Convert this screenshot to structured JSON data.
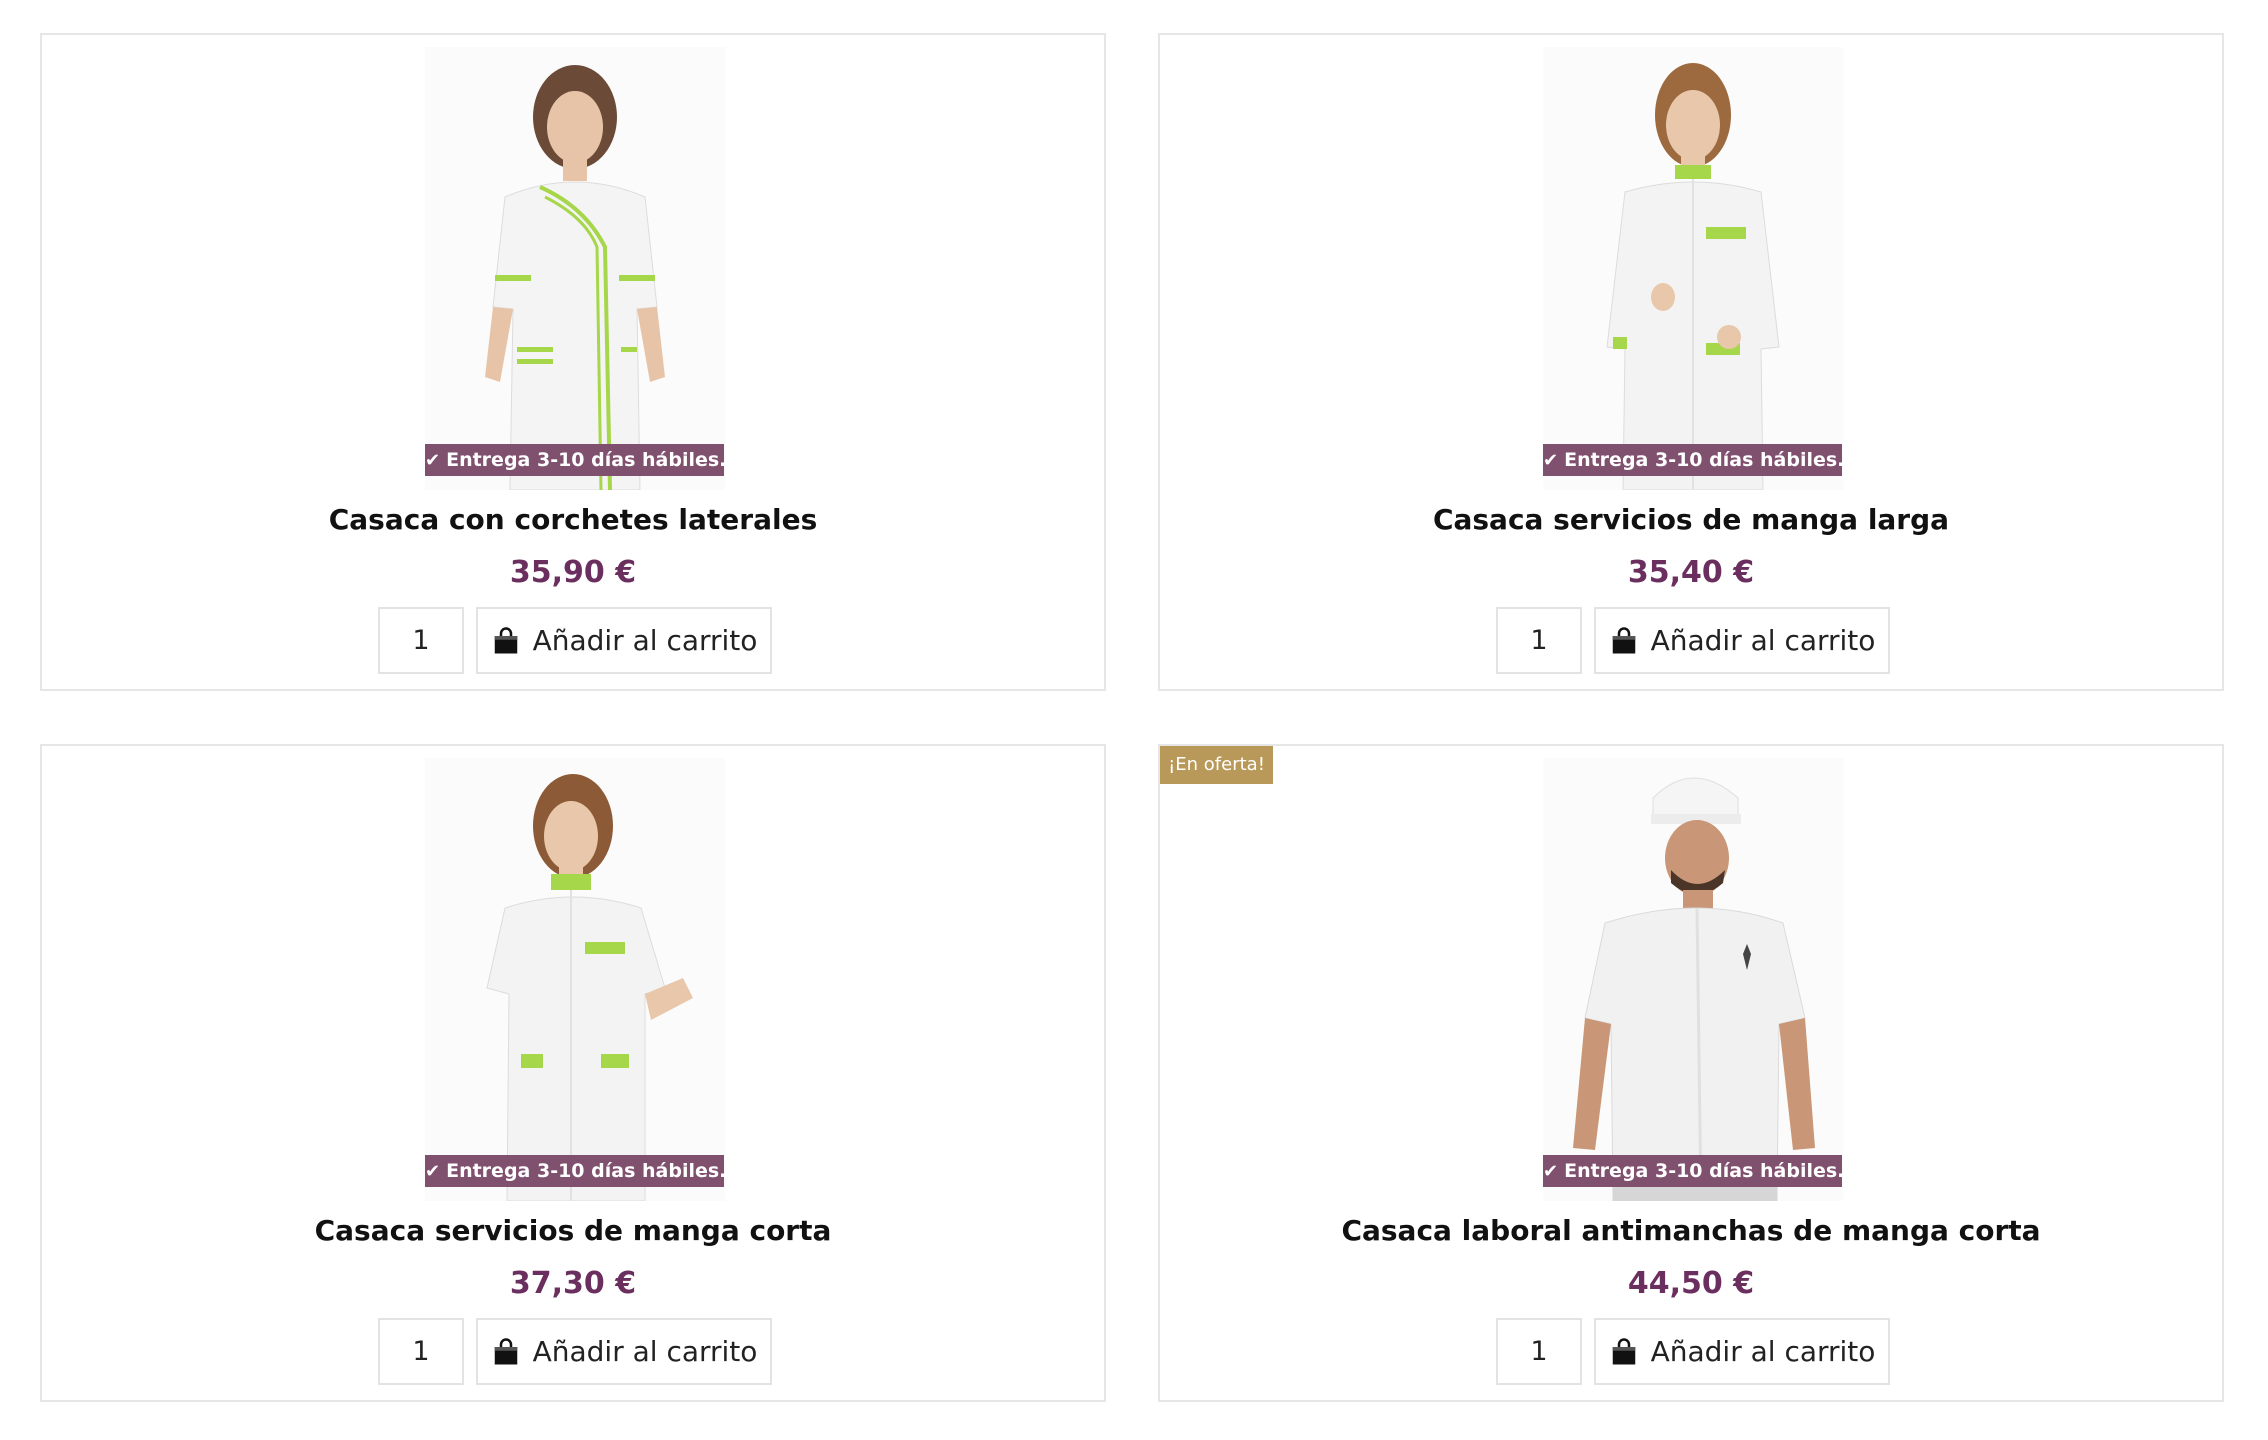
{
  "badge_text": "Entrega 3-10 días hábiles.",
  "add_to_cart_label": "Añadir al carrito",
  "products": [
    {
      "title": "Casaca con corchetes laterales",
      "price": "35,90 €",
      "quantity": "1"
    },
    {
      "title": "Casaca servicios de manga larga",
      "price": "35,40 €",
      "quantity": "1"
    },
    {
      "title": "Casaca servicios de manga corta",
      "price": "37,30 €",
      "quantity": "1"
    },
    {
      "title": "Casaca laboral antimanchas de manga corta",
      "price": "44,50 €",
      "quantity": "1",
      "sale_label": "¡En oferta!"
    }
  ],
  "colors": {
    "badge": "#80506f",
    "price": "#6b2f5f",
    "sale": "#b8995a",
    "accent_trim": "#a6d64a"
  },
  "icons": {
    "badge": "check-icon",
    "cart": "shopping-bag-icon"
  }
}
